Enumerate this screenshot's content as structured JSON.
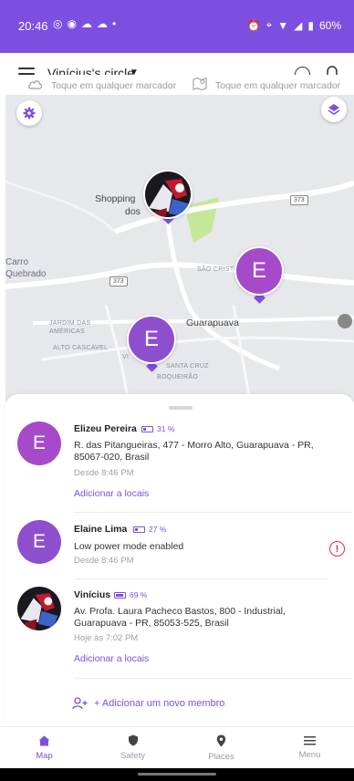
{
  "status_bar": {
    "time": "20:46",
    "battery": "60%"
  },
  "header": {
    "circle_name": "Vinícius's circle"
  },
  "subbar": {
    "weather_hint": "Toque em qualquer marcador",
    "places_hint": "Toque em qualquer marcador"
  },
  "map": {
    "labels": {
      "shopping_line1": "Shopping",
      "shopping_line2": "dos",
      "carro_line1": "Carro",
      "carro_line2": "Quebrado",
      "sao_cristo": "SÃO CRISTO",
      "jardim_line1": "JARDIM DAS",
      "jardim_line2": "AMÉRICAS",
      "alto_cascavel": "ALTO CASCAVEL",
      "guarapuava": "Guarapuava",
      "santa_cruz": "SANTA CRUZ",
      "boqueirao": "BOQUEIRÃO",
      "vi": "VI"
    },
    "route_373_a": "373",
    "route_373_b": "373",
    "marker_e1": "E",
    "marker_e2": "E"
  },
  "members": [
    {
      "initial": "E",
      "name": "Elizeu Pereira",
      "battery": "31 %",
      "battery_level": 0.31,
      "address": "R. das Pitangueiras, 477 - Morro Alto, Guarapuava - PR, 85067-020, Brasil",
      "since": "Desde 8:46 PM",
      "link": "Adicionar a locais",
      "color": "#a64ac9"
    },
    {
      "initial": "E",
      "name": "Elaine Lima",
      "battery": "27 %",
      "battery_level": 0.27,
      "status": "Low power mode enabled",
      "since": "Desde 8:46 PM",
      "color": "#8e4fcf"
    },
    {
      "name": "Vinícius",
      "battery": "69 %",
      "battery_level": 0.69,
      "address": "Av. Profa. Laura Pacheco Bastos, 800 - Industrial, Guarapuava - PR, 85053-525, Brasil",
      "since": "Hoje às 7:02 PM",
      "link": "Adicionar a locais"
    }
  ],
  "add_member": "+ Adicionar um novo membro",
  "nav": {
    "map": "Map",
    "safety": "Safety",
    "places": "Places",
    "menu": "Menu"
  },
  "colors": {
    "accent": "#7d4fe0",
    "alert": "#e0303a"
  }
}
